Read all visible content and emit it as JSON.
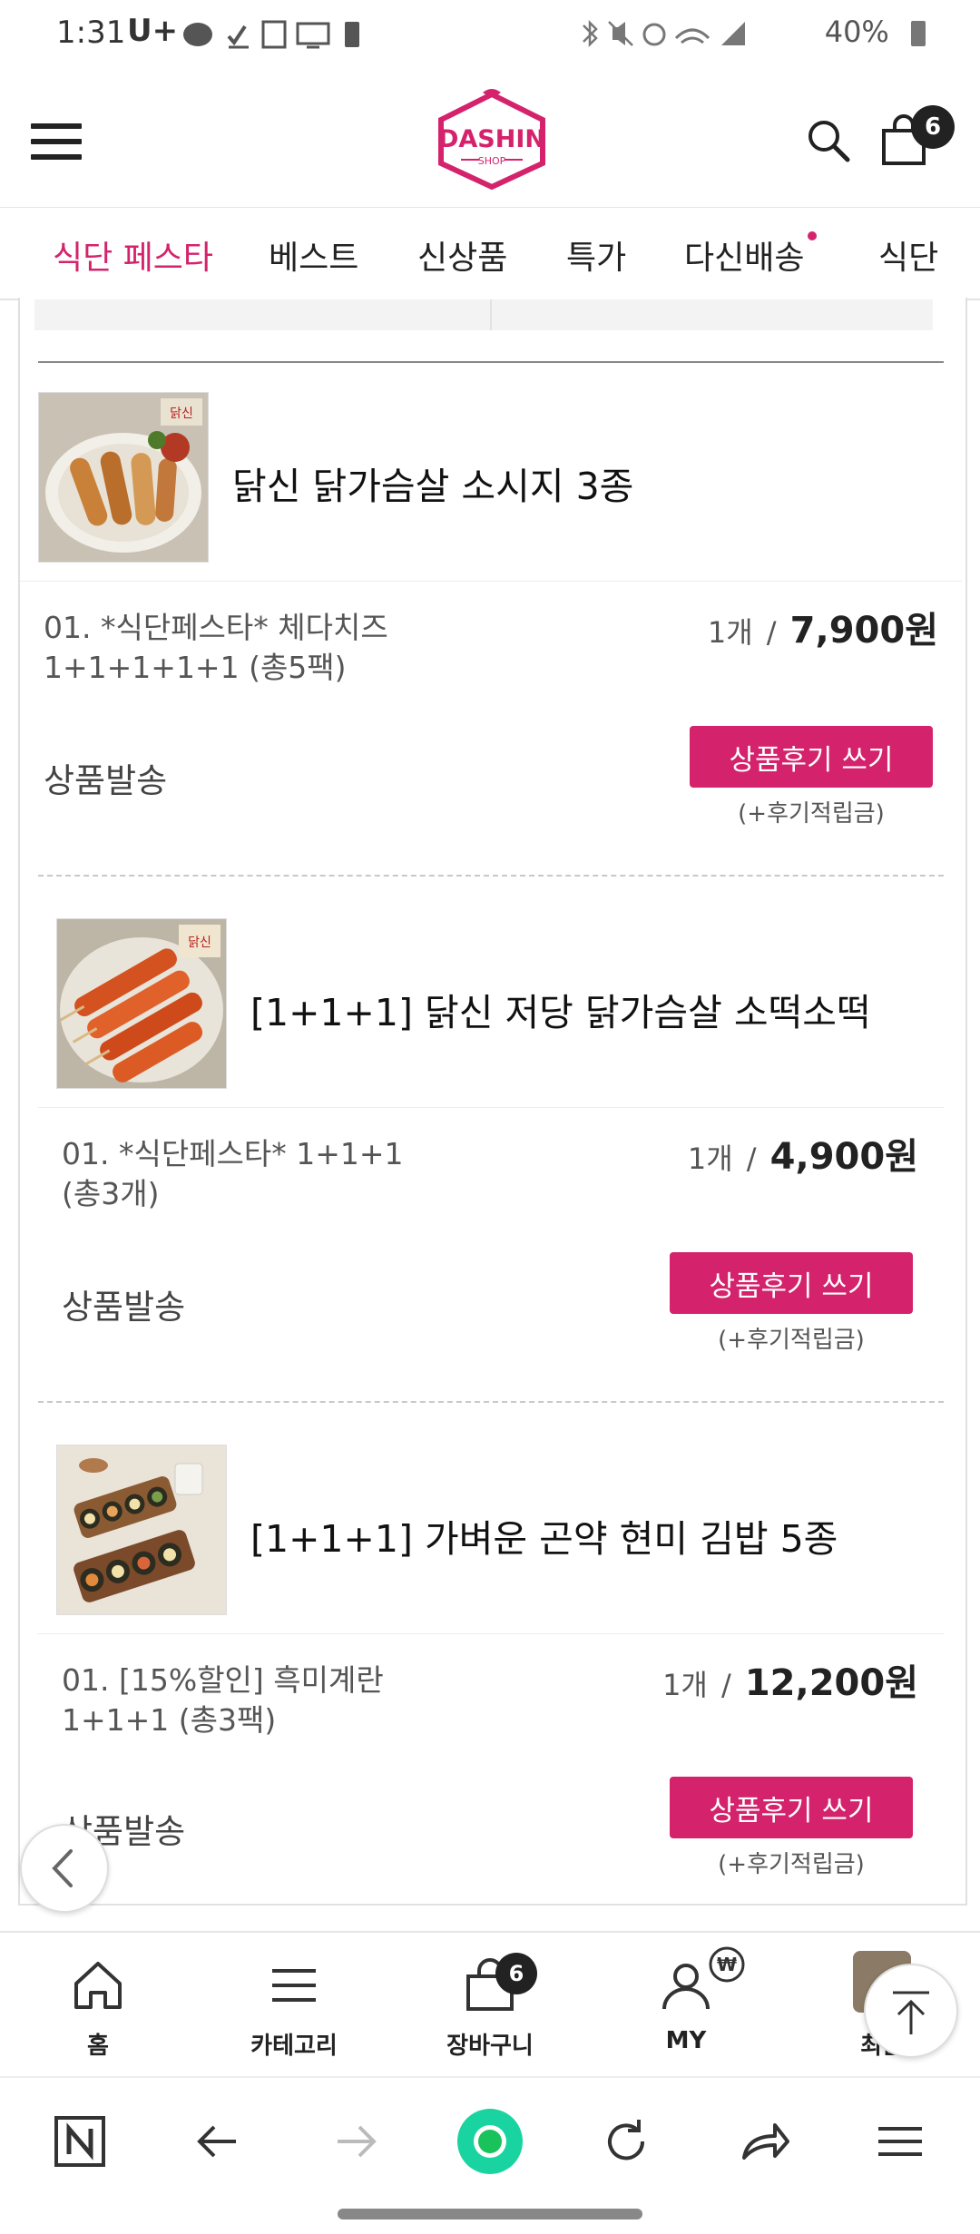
{
  "status_bar": {
    "time": "1:31",
    "carrier": "U+",
    "battery": "40%"
  },
  "header": {
    "logo_text": "DASHIN",
    "logo_sub": "SHOP",
    "cart_count": "6"
  },
  "tabs": [
    {
      "label": "식단 페스타",
      "active": true
    },
    {
      "label": "베스트"
    },
    {
      "label": "신상품"
    },
    {
      "label": "특가"
    },
    {
      "label": "다신배송"
    },
    {
      "label": "식단"
    }
  ],
  "orders": [
    {
      "title": "닭신 닭가슴살 소시지 3종",
      "option_line1": "01. *식단페스타* 체다치즈",
      "option_line2": "1+1+1+1+1 (총5팩)",
      "qty": "1개",
      "price": "7,900원",
      "status": "상품발송",
      "review_btn": "상품후기 쓰기",
      "reward": "(+후기적립금)"
    },
    {
      "title": "[1+1+1] 닭신 저당 닭가슴살 소떡소떡",
      "option_line1": "01. *식단페스타* 1+1+1",
      "option_line2": "(총3개)",
      "qty": "1개",
      "price": "4,900원",
      "status": "상품발송",
      "review_btn": "상품후기 쓰기",
      "reward": "(+후기적립금)"
    },
    {
      "title": "[1+1+1] 가벼운 곤약 현미 김밥 5종",
      "option_line1": "01. [15%할인] 흑미계란",
      "option_line2": "1+1+1 (총3팩)",
      "qty": "1개",
      "price": "12,200원",
      "status": "상품발송",
      "review_btn": "상품후기 쓰기",
      "reward": "(+후기적립금)"
    }
  ],
  "bottom_nav": {
    "home": "홈",
    "category": "카테고리",
    "cart": "장바구니",
    "cart_count": "6",
    "my": "MY",
    "recent": "최근"
  },
  "colors": {
    "brand": "#d4236c"
  }
}
